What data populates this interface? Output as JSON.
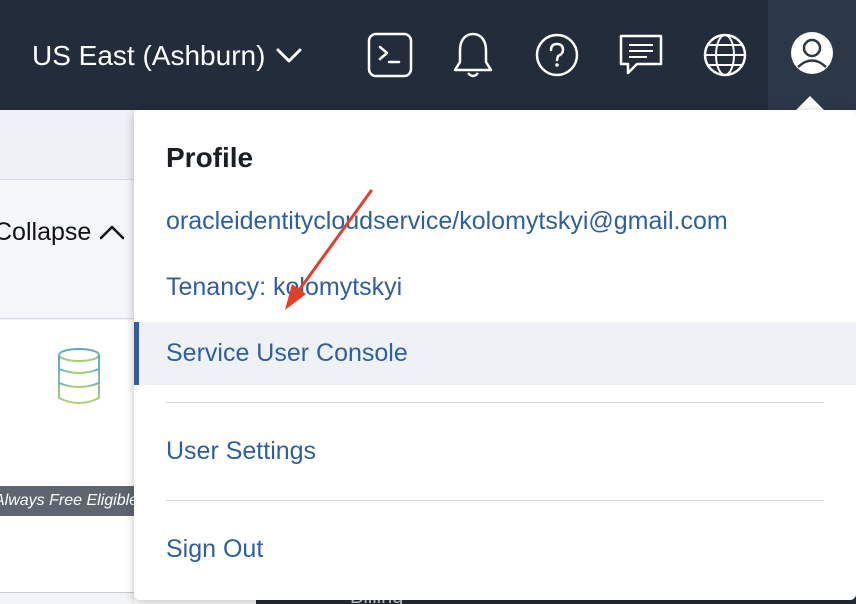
{
  "topbar": {
    "region_label": "US East (Ashburn)",
    "icons": [
      "cloud-shell-icon",
      "notifications-icon",
      "help-icon",
      "chat-icon",
      "language-icon",
      "profile-icon"
    ]
  },
  "background": {
    "collapse_label": "Collapse",
    "free_badge": "Always Free Eligible",
    "bottom_text": "Billing"
  },
  "profile_menu": {
    "title": "Profile",
    "email": "oracleidentitycloudservice/kolomytskyi@gmail.com",
    "tenancy": "Tenancy: kolomytskyi",
    "service_user_console": "Service User Console",
    "user_settings": "User Settings",
    "sign_out": "Sign Out"
  },
  "colors": {
    "topbar_bg": "#222c3a",
    "link": "#2f5f9c",
    "highlight_bg": "#eef2f7",
    "annotation_arrow": "#e0402a"
  }
}
